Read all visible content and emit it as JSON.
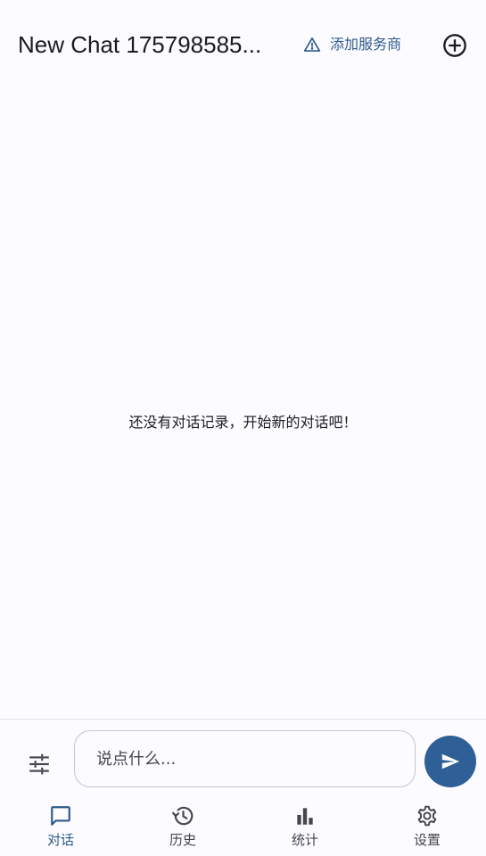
{
  "header": {
    "title": "New Chat 175798585...",
    "provider_label": "添加服务商"
  },
  "empty_state": {
    "message": "还没有对话记录，开始新的对话吧！"
  },
  "composer": {
    "placeholder": "说点什么..."
  },
  "nav": {
    "items": [
      {
        "label": "对话",
        "icon": "chat-icon",
        "active": true
      },
      {
        "label": "历史",
        "icon": "history-icon",
        "active": false
      },
      {
        "label": "统计",
        "icon": "bar-chart-icon",
        "active": false
      },
      {
        "label": "设置",
        "icon": "gear-icon",
        "active": false
      }
    ]
  },
  "colors": {
    "accent": "#2e5a8c",
    "send_button": "#2e5f96",
    "background": "#fcfbff",
    "text": "#1b1b1f",
    "muted": "#44474e"
  }
}
